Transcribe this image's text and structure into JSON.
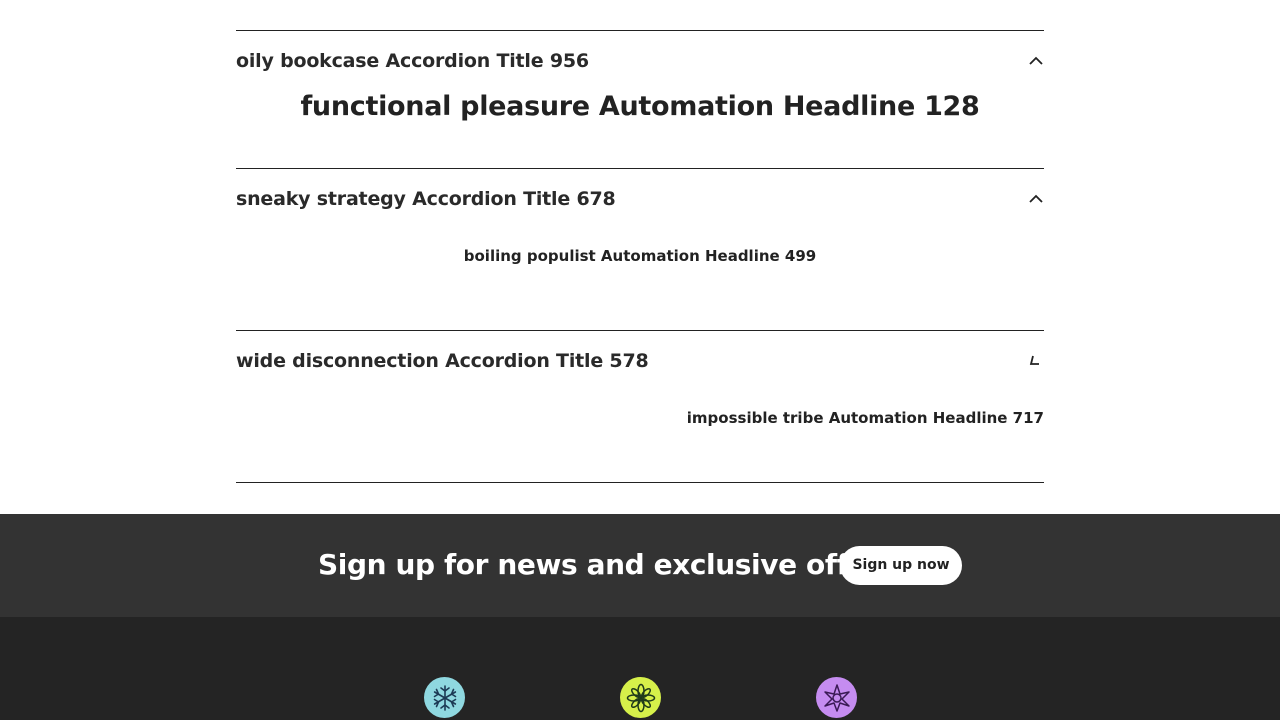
{
  "accordion": {
    "items": [
      {
        "title": "oily bookcase Accordion Title 956",
        "headline": "functional pleasure Automation Headline 128",
        "chevron": "chevron-up-icon"
      },
      {
        "title": "sneaky strategy Accordion Title 678",
        "headline": "boiling populist Automation Headline 499",
        "chevron": "chevron-up-icon"
      },
      {
        "title": "wide disconnection Accordion Title 578",
        "headline": "impossible tribe Automation Headline 717",
        "chevron": "chevron-rotating-icon"
      }
    ]
  },
  "signup": {
    "text": "Sign up for news and exclusive offers",
    "button_label": "Sign up now"
  },
  "footer": {
    "badges": [
      {
        "icon": "snowflake-icon",
        "color": "#8fd8e0"
      },
      {
        "icon": "flower-icon",
        "color": "#d6f04a"
      },
      {
        "icon": "star-icon",
        "color": "#c58cf0"
      }
    ]
  },
  "colors": {
    "text": "#222222",
    "signup_band": "#333333",
    "footer": "#242424"
  }
}
